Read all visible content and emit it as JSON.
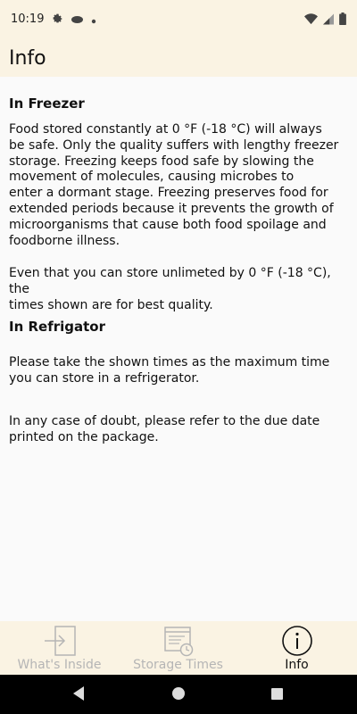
{
  "status_bar": {
    "time": "10:19",
    "left_icons": [
      "gear-icon",
      "cloud-icon",
      "dot-icon"
    ],
    "right_icons": [
      "wifi-icon",
      "signal-icon",
      "battery-icon"
    ]
  },
  "app_bar": {
    "title": "Info"
  },
  "sections": {
    "freezer": {
      "title": "In Freezer",
      "paragraph1": "Food stored constantly at 0 °F (-18 °C) will always\nbe safe. Only the quality suffers with lengthy freezer\nstorage. Freezing keeps food safe by slowing the\nmovement of molecules, causing microbes to\nenter a dormant stage. Freezing preserves food for\nextended periods because it prevents the growth of\nmicroorganisms that cause both food spoilage and\nfoodborne illness.",
      "paragraph2": "Even that you can store unlimeted by 0 °F (-18 °C), the\ntimes shown are for best quality."
    },
    "refrigerator": {
      "title": "In Refrigator",
      "paragraph1": "Please take the shown times as the maximum time\nyou can store in a refrigerator.",
      "paragraph2": "In any case of doubt, please refer to the due date\nprinted on the package."
    }
  },
  "bottom_nav": {
    "items": [
      {
        "label": "What's Inside",
        "icon": "login-icon",
        "active": false
      },
      {
        "label": "Storage Times",
        "icon": "calendar-clock-icon",
        "active": false
      },
      {
        "label": "Info",
        "icon": "info-icon",
        "active": true
      }
    ]
  },
  "colors": {
    "bar_background": "#faf3e3",
    "content_background": "#fafafa",
    "inactive_label": "#b5b5b5",
    "active_label": "#111111"
  }
}
